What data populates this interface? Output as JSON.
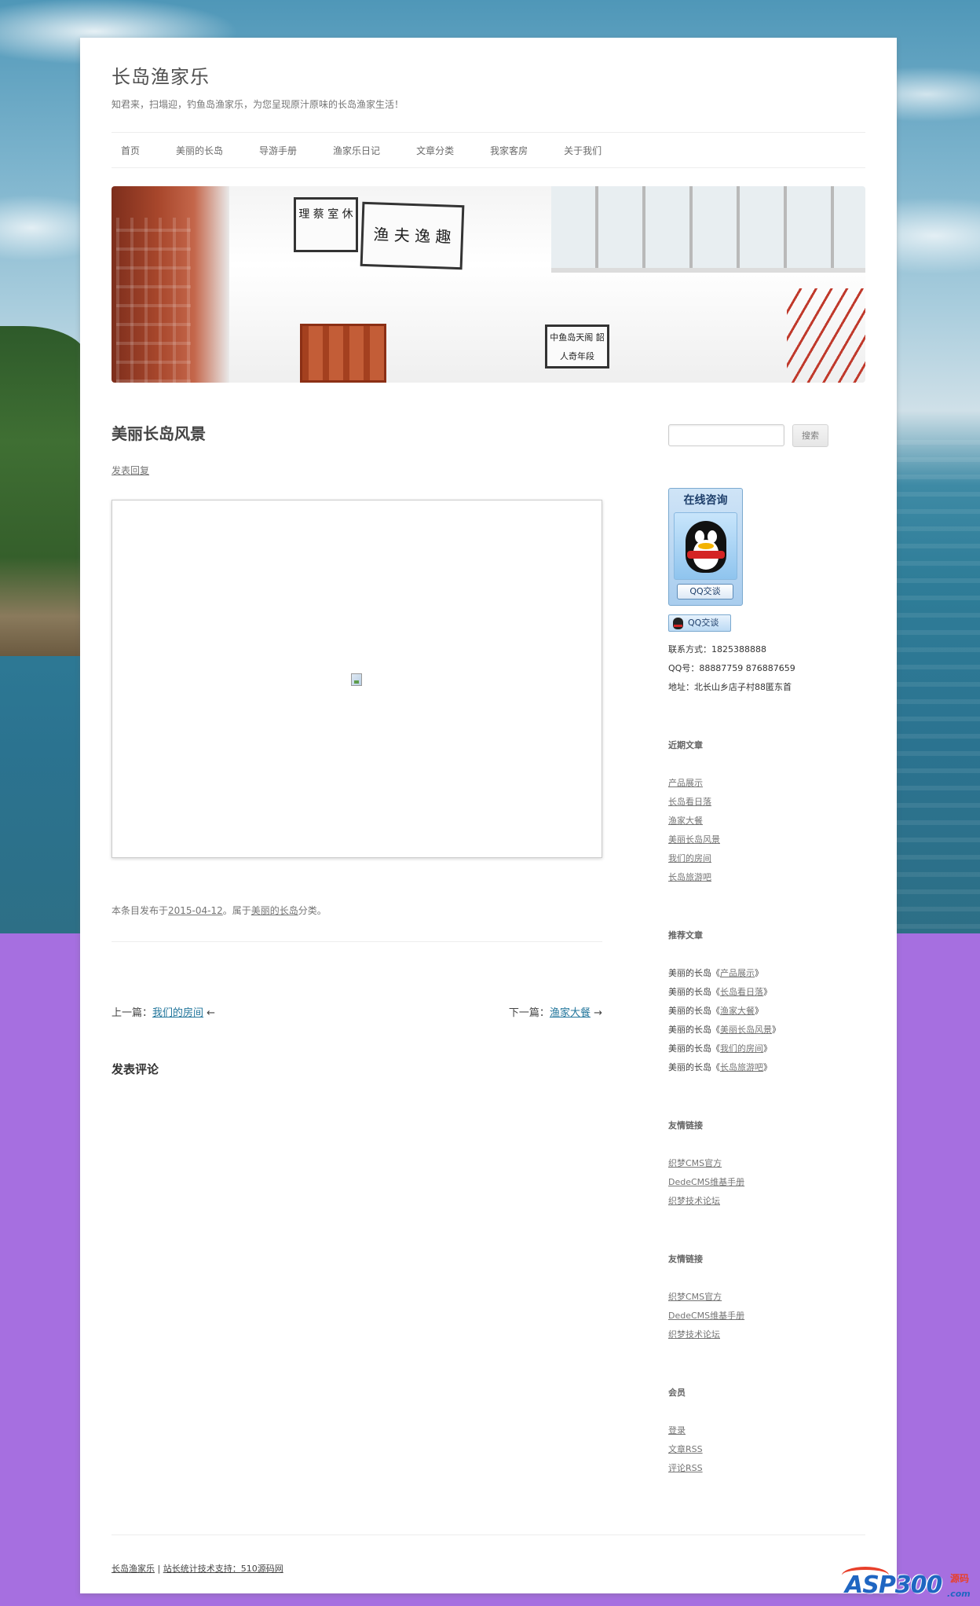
{
  "site": {
    "title": "长岛渔家乐",
    "tagline": "知君来，扫塌迎，钓鱼岛渔家乐，为您呈现原汁原味的长岛渔家生活！"
  },
  "nav": {
    "items": [
      "首页",
      "美丽的长岛",
      "导游手册",
      "渔家乐日记",
      "文章分类",
      "我家客房",
      "关于我们"
    ]
  },
  "header_image": {
    "signs": [
      "理 蔡 室 休",
      "渔 夫 逸 趣",
      "中鱼岛天阁 韶人奇年段"
    ]
  },
  "post": {
    "title": "美丽长岛风景",
    "reply_link": "发表回复",
    "meta_prefix": "本条目发布于",
    "meta_date": "2015-04-12",
    "meta_mid": "。属于",
    "meta_category": "美丽的长岛",
    "meta_suffix": "分类。"
  },
  "post_nav": {
    "prev_label": "上一篇：",
    "prev_link": "我们的房间",
    "prev_arrow": "←",
    "next_label": "下一篇：",
    "next_link": "渔家大餐",
    "next_arrow": "→"
  },
  "comments": {
    "title": "发表评论"
  },
  "search": {
    "button": "搜索",
    "placeholder": ""
  },
  "qq": {
    "panel_title": "在线咨询",
    "chat_button": "QQ交谈",
    "small_button": "QQ交谈",
    "contact": "联系方式：1825388888",
    "qq_numbers": "QQ号：88887759 876887659",
    "address": "地址：北长山乡店子村88匿东首"
  },
  "recent": {
    "title": "近期文章",
    "items": [
      "产品展示",
      "长岛看日落",
      "渔家大餐",
      "美丽长岛风景",
      "我们的房间",
      "长岛旅游吧"
    ]
  },
  "recommended": {
    "title": "推荐文章",
    "items": [
      {
        "prefix": "美丽的长岛《",
        "link": "产品展示",
        "suffix": "》"
      },
      {
        "prefix": "美丽的长岛《",
        "link": "长岛看日落",
        "suffix": "》"
      },
      {
        "prefix": "美丽的长岛《",
        "link": "渔家大餐",
        "suffix": "》"
      },
      {
        "prefix": "美丽的长岛《",
        "link": "美丽长岛风景",
        "suffix": "》"
      },
      {
        "prefix": "美丽的长岛《",
        "link": "我们的房间",
        "suffix": "》"
      },
      {
        "prefix": "美丽的长岛《",
        "link": "长岛旅游吧",
        "suffix": "》"
      }
    ]
  },
  "links1": {
    "title": "友情链接",
    "items": [
      "织梦CMS官方",
      "DedeCMS维基手册",
      "织梦技术论坛"
    ]
  },
  "links2": {
    "title": "友情链接",
    "items": [
      "织梦CMS官方",
      "DedeCMS维基手册",
      "织梦技术论坛"
    ]
  },
  "members": {
    "title": "会员",
    "items": [
      "登录",
      "文章RSS",
      "评论RSS"
    ]
  },
  "footer": {
    "site_link": "长岛渔家乐",
    "separator": "|",
    "stats": "站长统计技术支持：",
    "support_link": "510源码网"
  },
  "watermark": {
    "logo": "ASP300",
    "sub": "源码",
    "com": ".com"
  }
}
